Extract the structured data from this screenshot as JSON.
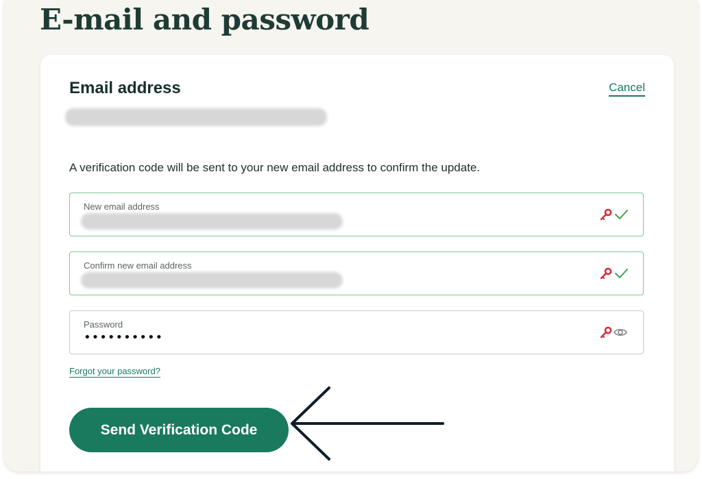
{
  "page": {
    "title": "E-mail and password"
  },
  "email_section": {
    "title": "Email address",
    "cancel_label": "Cancel",
    "info_text": "A verification code will be sent to your new email address to confirm the update."
  },
  "fields": [
    {
      "label": "New email address",
      "state": "valid",
      "value": ""
    },
    {
      "label": "Confirm new email address",
      "state": "valid",
      "value": ""
    },
    {
      "label": "Password",
      "state": "neutral",
      "value": "••••••••••"
    }
  ],
  "forgot_password_label": "Forgot your password?",
  "send_button_label": "Send Verification Code",
  "icons": {
    "autofill": "key-icon",
    "valid": "checkmark-icon",
    "reveal": "eye-icon",
    "annotation": "arrow-left-icon"
  },
  "colors": {
    "brand_green": "#1a7a5e",
    "link_green": "#187a5a",
    "valid_border": "#7ec38e",
    "check_green": "#3ea34f",
    "key_red": "#d0313b",
    "title_text": "#1f3b36",
    "panel_bg": "#f7f5ef"
  }
}
